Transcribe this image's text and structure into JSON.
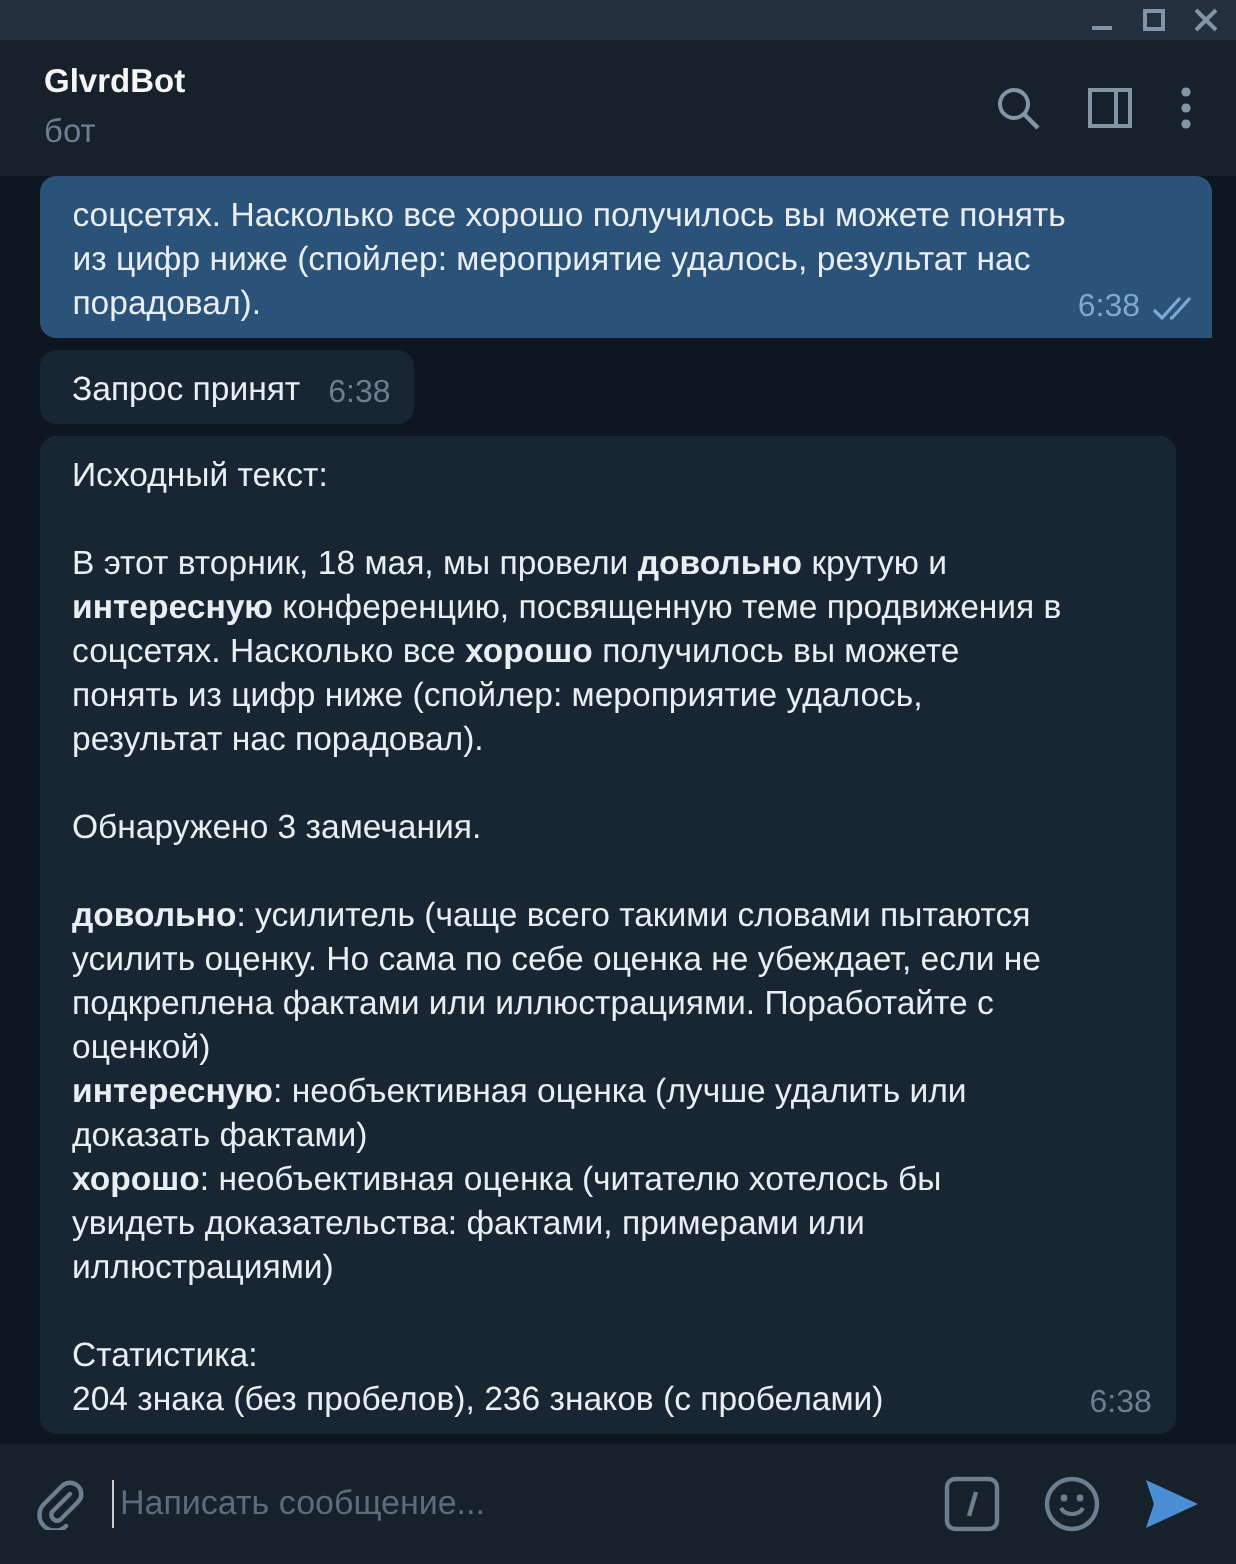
{
  "header": {
    "title": "GlvrdBot",
    "subtitle": "бот"
  },
  "messages": [
    {
      "kind": "outgoing",
      "paragraphs": [
        "соцсетях. Насколько все хорошо получилось вы можете понять\nиз цифр ниже (спойлер: мероприятие удалось, результат нас\nпорадовал)."
      ],
      "time": "6:38",
      "read": true
    },
    {
      "kind": "incoming",
      "paragraphs": [
        "Запрос принят"
      ],
      "time": "6:38"
    },
    {
      "kind": "incoming",
      "paragraphs": [
        "Исходный текст:",
        "В этот вторник, 18 мая, мы провели **довольно** крутую и\n**интересную** конференцию, посвященную теме продвижения в\nсоцсетях. Насколько все **хорошо** получилось вы можете\nпонять из цифр ниже (спойлер: мероприятие удалось,\nрезультат нас порадовал).",
        "Обнаружено 3 замечания.",
        "**довольно**: усилитель (чаще всего такими словами пытаются\nусилить оценку. Но сама по себе оценка не убеждает, если не\nподкреплена фактами или иллюстрациями. Поработайте с\nоценкой)\n**интересную**: необъективная оценка (лучше удалить или\nдоказать фактами)\n**хорошо**: необъективная оценка (читателю хотелось бы\nувидеть доказательства: фактами, примерами или\nиллюстрациями)",
        "Статистика:\n204 знака (без пробелов), 236 знаков (с пробелами)"
      ],
      "time": "6:38"
    }
  ],
  "composer": {
    "placeholder": "Написать сообщение..."
  }
}
